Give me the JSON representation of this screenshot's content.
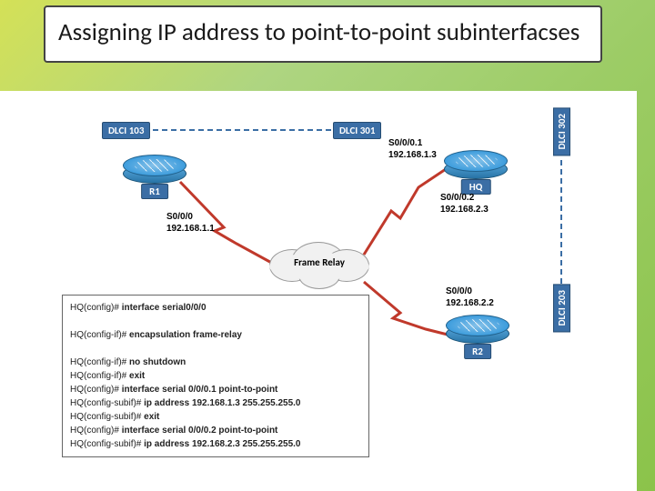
{
  "title": "Assigning IP address to point-to-point subinterfacses",
  "routers": {
    "r1": {
      "label": "R1",
      "iface": "S0/0/0",
      "ip": "192.168.1.1",
      "dlci": "DLCI  103"
    },
    "hq": {
      "label": "HQ",
      "sub1": {
        "iface": "S0/0/0.1",
        "ip": "192.168.1.3",
        "dlci": "DLCI 301"
      },
      "sub2": {
        "iface": "S0/0/0.2",
        "ip": "192.168.2.3",
        "dlci": "DLCI 302"
      }
    },
    "r2": {
      "label": "R2",
      "iface": "S0/0/0",
      "ip": "192.168.2.2",
      "dlci": "DLCI 203"
    }
  },
  "cloud": "Frame Relay",
  "cli": [
    {
      "prompt": "HQ(config)# ",
      "cmd": "interface serial0/0/0"
    },
    {
      "prompt": "",
      "cmd": ""
    },
    {
      "prompt": "HQ(config-if)# ",
      "cmd": "encapsulation frame-relay"
    },
    {
      "prompt": "",
      "cmd": ""
    },
    {
      "prompt": "HQ(config-if)# ",
      "cmd": "no shutdown"
    },
    {
      "prompt": "HQ(config-if)# ",
      "cmd": "exit"
    },
    {
      "prompt": "HQ(config)# ",
      "cmd": "interface serial 0/0/0.1 point-to-point"
    },
    {
      "prompt": "HQ(config-subif)# ",
      "cmd": "ip address 192.168.1.3 255.255.255.0"
    },
    {
      "prompt": "HQ(config-subif)# ",
      "cmd": "exit"
    },
    {
      "prompt": "HQ(config)# ",
      "cmd": "interface serial 0/0/0.2 point-to-point"
    },
    {
      "prompt": "HQ(config-subif)# ",
      "cmd": "ip address 192.168.2.3 255.255.255.0"
    }
  ]
}
